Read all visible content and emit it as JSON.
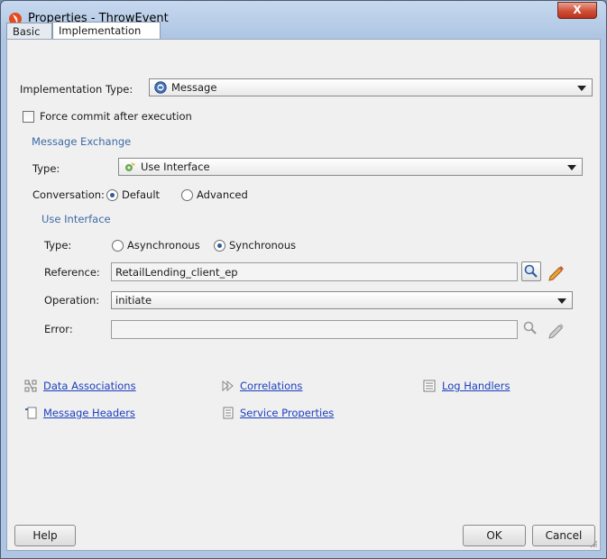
{
  "window": {
    "title": "Properties - ThrowEvent",
    "close_label": "X"
  },
  "tabs": [
    {
      "label": "Basic"
    },
    {
      "label": "Implementation"
    }
  ],
  "implementation": {
    "type_label": "Implementation Type:",
    "type_value": "Message",
    "force_commit_label": "Force commit after execution",
    "force_commit_checked": false
  },
  "message_exchange": {
    "heading": "Message Exchange",
    "type_label": "Type:",
    "type_value": "Use Interface",
    "conversation_label": "Conversation:",
    "conversation_options": [
      "Default",
      "Advanced"
    ],
    "conversation_selected": "Default"
  },
  "use_interface": {
    "heading": "Use Interface",
    "type_label": "Type:",
    "type_options": [
      "Asynchronous",
      "Synchronous"
    ],
    "type_selected": "Synchronous",
    "reference_label": "Reference:",
    "reference_value": "RetailLending_client_ep",
    "operation_label": "Operation:",
    "operation_value": "initiate",
    "error_label": "Error:",
    "error_value": ""
  },
  "links": {
    "data_associations": "Data Associations",
    "correlations": "Correlations",
    "log_handlers": "Log Handlers",
    "message_headers": "Message Headers",
    "service_properties": "Service Properties"
  },
  "footer": {
    "help": "Help",
    "ok": "OK",
    "cancel": "Cancel"
  },
  "icons": [
    "oracle-app-icon",
    "message-icon",
    "use-interface-icon",
    "search-icon",
    "edit-pencil-icon",
    "data-associations-icon",
    "correlations-icon",
    "log-handlers-icon",
    "message-headers-icon",
    "service-properties-icon"
  ]
}
